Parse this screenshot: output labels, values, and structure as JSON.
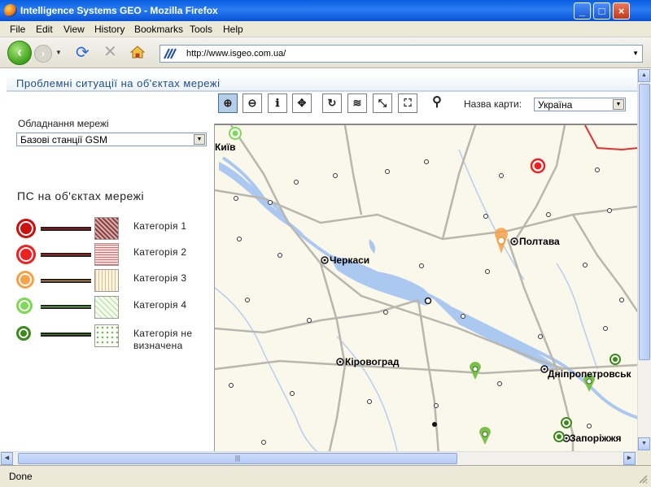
{
  "window": {
    "title": "Intelligence Systems GEO - Mozilla Firefox",
    "minimize": "_",
    "maximize": "□",
    "close": "×"
  },
  "menu": [
    "File",
    "Edit",
    "View",
    "History",
    "Bookmarks",
    "Tools",
    "Help"
  ],
  "nav": {
    "url": "http://www.isgeo.com.ua/"
  },
  "page": {
    "title": "Проблемні ситуації на об'єктах мережі",
    "equipment_label": "Обладнання мережі",
    "equipment_value": "Базові станції GSM",
    "ps_heading": "ПС на об'єктах мережі",
    "map_name_label": "Назва карти:",
    "map_name_value": "Україна"
  },
  "legend": [
    {
      "label": "Категорія 1",
      "color": "#cc1111",
      "fill": "#b08080"
    },
    {
      "label": "Категорія 2",
      "color": "#ee2222",
      "fill": "#f2a6a6"
    },
    {
      "label": "Категорія 3",
      "color": "#f5a24a",
      "fill": "#fbe0c4"
    },
    {
      "label": "Категорія 4",
      "color": "#7ed957",
      "fill": "#e3f6d5"
    },
    {
      "label": "Категорія не визначена",
      "color": "#3c8a1c",
      "fill": "#f4f9ee"
    }
  ],
  "toolbar_icons": [
    "zoom-in-icon",
    "zoom-out-icon",
    "info-icon",
    "pan-icon",
    "refresh-icon",
    "layers-icon",
    "zoom-extent-icon",
    "full-screen-icon",
    "find-icon"
  ],
  "map": {
    "cities": [
      "Київ",
      "Полтава",
      "Черкаси",
      "Кіровоград",
      "Дніпропетровськ",
      "Запоріжжя"
    ]
  },
  "status": {
    "text": "Done"
  }
}
